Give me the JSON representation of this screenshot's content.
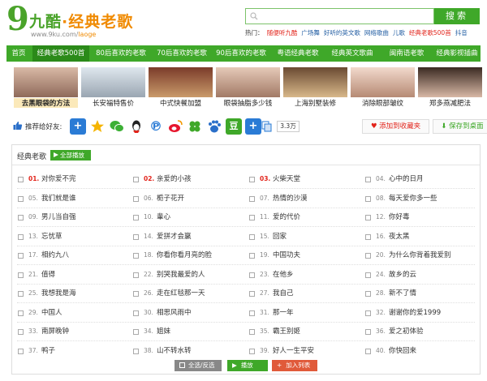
{
  "site": {
    "logo_nine": "9",
    "name_main": "九酷",
    "name_dot": "·",
    "name_sub": "经典老歌",
    "url_main": "www.9ku.com/",
    "url_sub": "laoge"
  },
  "search": {
    "placeholder": "",
    "button": "搜索"
  },
  "hot": {
    "label": "热门：",
    "links": [
      {
        "text": "随便听九酷",
        "style": "red"
      },
      {
        "text": "广场舞",
        "style": "blue"
      },
      {
        "text": "好听的英文歌",
        "style": "blue"
      },
      {
        "text": "网络歌曲",
        "style": "blue"
      },
      {
        "text": "儿歌",
        "style": "blue"
      },
      {
        "text": "经典老歌500首",
        "style": "red"
      },
      {
        "text": "抖音",
        "style": "blue"
      }
    ]
  },
  "nav": [
    "首页",
    "经典老歌500首",
    "80后喜欢的老歌",
    "70后喜欢的老歌",
    "90后喜欢的老歌",
    "粤语经典老歌",
    "经典英文歌曲",
    "闽南语老歌",
    "经典影视插曲"
  ],
  "thumbs": [
    {
      "caption": "去黑眼袋的方法"
    },
    {
      "caption": "长安福特售价"
    },
    {
      "caption": "中式快餐加盟"
    },
    {
      "caption": "眼袋抽脂多少钱"
    },
    {
      "caption": "上海别墅装修"
    },
    {
      "caption": "消除眼部皱纹"
    },
    {
      "caption": "郑多燕减肥法"
    }
  ],
  "share": {
    "label": "推荐给好友:",
    "count": "3.3万",
    "favorite": "添加到收藏夹",
    "save_desktop": "保存到桌面"
  },
  "list": {
    "title": "经典老歌",
    "play_all": "全部播放",
    "songs": [
      [
        "01.",
        "对你爱不完"
      ],
      [
        "02.",
        "亲爱的小孩"
      ],
      [
        "03.",
        "火柴天堂"
      ],
      [
        "04.",
        "心中的日月"
      ],
      [
        "05.",
        "我们就是谁"
      ],
      [
        "06.",
        "栀子花开"
      ],
      [
        "07.",
        "热情的沙漠"
      ],
      [
        "08.",
        "每天爱你多一些"
      ],
      [
        "09.",
        "男儿当自强"
      ],
      [
        "10.",
        "輩心"
      ],
      [
        "11.",
        "爱的代价"
      ],
      [
        "12.",
        "你好毒"
      ],
      [
        "13.",
        "忘忧草"
      ],
      [
        "14.",
        "爱拼才会赢"
      ],
      [
        "15.",
        "回家"
      ],
      [
        "16.",
        "夜太黑"
      ],
      [
        "17.",
        "相约九八"
      ],
      [
        "18.",
        "你看你看月亮的脸"
      ],
      [
        "19.",
        "中国功夫"
      ],
      [
        "20.",
        "为什么你背着我爱别"
      ],
      [
        "21.",
        "值得"
      ],
      [
        "22.",
        "别哭我最爱的人"
      ],
      [
        "23.",
        "在他乡"
      ],
      [
        "24.",
        "故乡的云"
      ],
      [
        "25.",
        "我想我是海"
      ],
      [
        "26.",
        "走在红毯那一天"
      ],
      [
        "27.",
        "我自己"
      ],
      [
        "28.",
        "新不了情"
      ],
      [
        "29.",
        "中国人"
      ],
      [
        "30.",
        "相思风雨中"
      ],
      [
        "31.",
        "那一年"
      ],
      [
        "32.",
        "谢谢你的爱1999"
      ],
      [
        "33.",
        "南屏晚钟"
      ],
      [
        "34.",
        "姐妹"
      ],
      [
        "35.",
        "霸王别姬"
      ],
      [
        "36.",
        "爱之初体验"
      ],
      [
        "37.",
        "鸭子"
      ],
      [
        "38.",
        "山不转水转"
      ],
      [
        "39.",
        "好人一生平安"
      ],
      [
        "40.",
        "你快回来"
      ]
    ],
    "select_all": "全选/反选",
    "play": "播放",
    "add_list": "加入列表"
  },
  "colors": {
    "green": "#3fa829",
    "nav_active": "#2b8a19",
    "orange": "#f08a00",
    "red": "#e2231a"
  }
}
